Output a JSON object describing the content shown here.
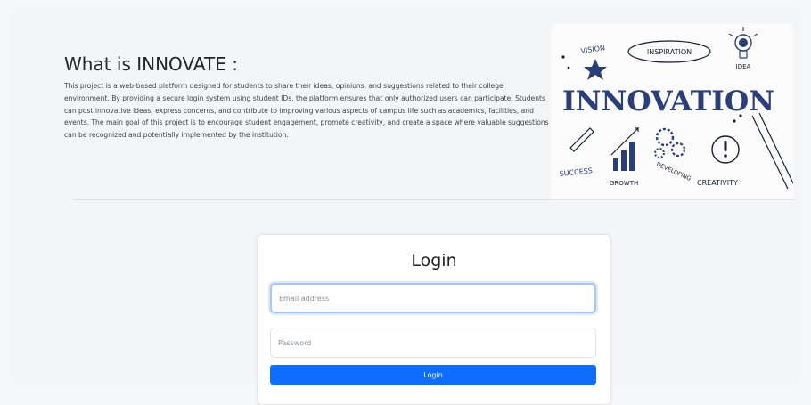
{
  "about": {
    "title": "What is INNOVATE :",
    "body": "This project is a web-based platform designed for students to share their ideas, opinions, and suggestions related to their college environment. By providing a secure login system using student IDs, the platform ensures that only authorized users can participate. Students can post innovative ideas, express concerns, and contribute to improving various aspects of campus life such as academics, facilities, and events. The main goal of this project is to encourage student engagement, promote creativity, and create a space where valuable suggestions can be recognized and potentially implemented by the institution."
  },
  "hero_image": {
    "headline": "INNOVATION",
    "words": {
      "vision": "VISION",
      "inspiration": "INSPIRATION",
      "idea": "IDEA",
      "success": "SUCCESS",
      "growth": "GROWTH",
      "developing": "DEVELOPING",
      "creativity": "CREATIVITY"
    },
    "colors": {
      "navy": "#2a3f7a",
      "ink": "#1b1f2a"
    }
  },
  "login": {
    "title": "Login",
    "email_placeholder": "Email address",
    "password_placeholder": "Password",
    "submit_label": "Login",
    "accent": "#0d6efd"
  }
}
